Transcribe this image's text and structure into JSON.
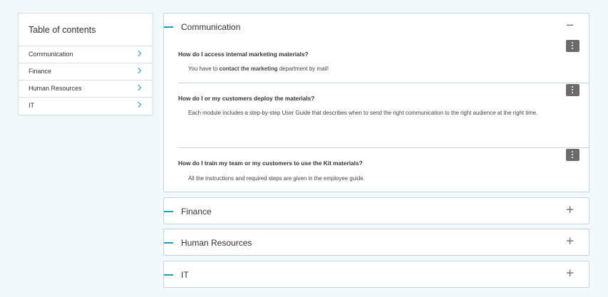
{
  "toc": {
    "title": "Table of contents",
    "items": [
      {
        "label": "Communication"
      },
      {
        "label": "Finance"
      },
      {
        "label": "Human Resources"
      },
      {
        "label": "IT"
      }
    ]
  },
  "panels": {
    "communication": {
      "title": "Communication",
      "toggle": "−",
      "expanded": true,
      "qa": [
        {
          "question": "How do I access internal marketing materials?",
          "answer_pre": "You have to ",
          "answer_bold": "contact the marketing",
          "answer_post": " department by mail!"
        },
        {
          "question": "How do I or my customers deploy the materials?",
          "answer": "Each module includes a step-by-step User Guide that describes when to send the right communication to the right audience at the right time."
        },
        {
          "question": "How do I train my team or my customers to use the Kit materials?",
          "answer": "All the instructions and  required steps are given in the employee  guide."
        }
      ]
    },
    "finance": {
      "title": "Finance",
      "toggle": "+",
      "expanded": false
    },
    "human_resources": {
      "title": "Human Resources",
      "toggle": "+",
      "expanded": false
    },
    "it": {
      "title": "IT",
      "toggle": "+",
      "expanded": false
    }
  },
  "colors": {
    "accent": "#16a0c8",
    "background": "#f1f9fc",
    "border": "#c5d6e1",
    "kebab": "#6b6b6b"
  },
  "icons": {
    "toc_chevron": "chevron-right-icon",
    "panel_collapse": "minus-icon",
    "panel_expand": "plus-icon",
    "item_menu": "kebab-menu-icon"
  }
}
